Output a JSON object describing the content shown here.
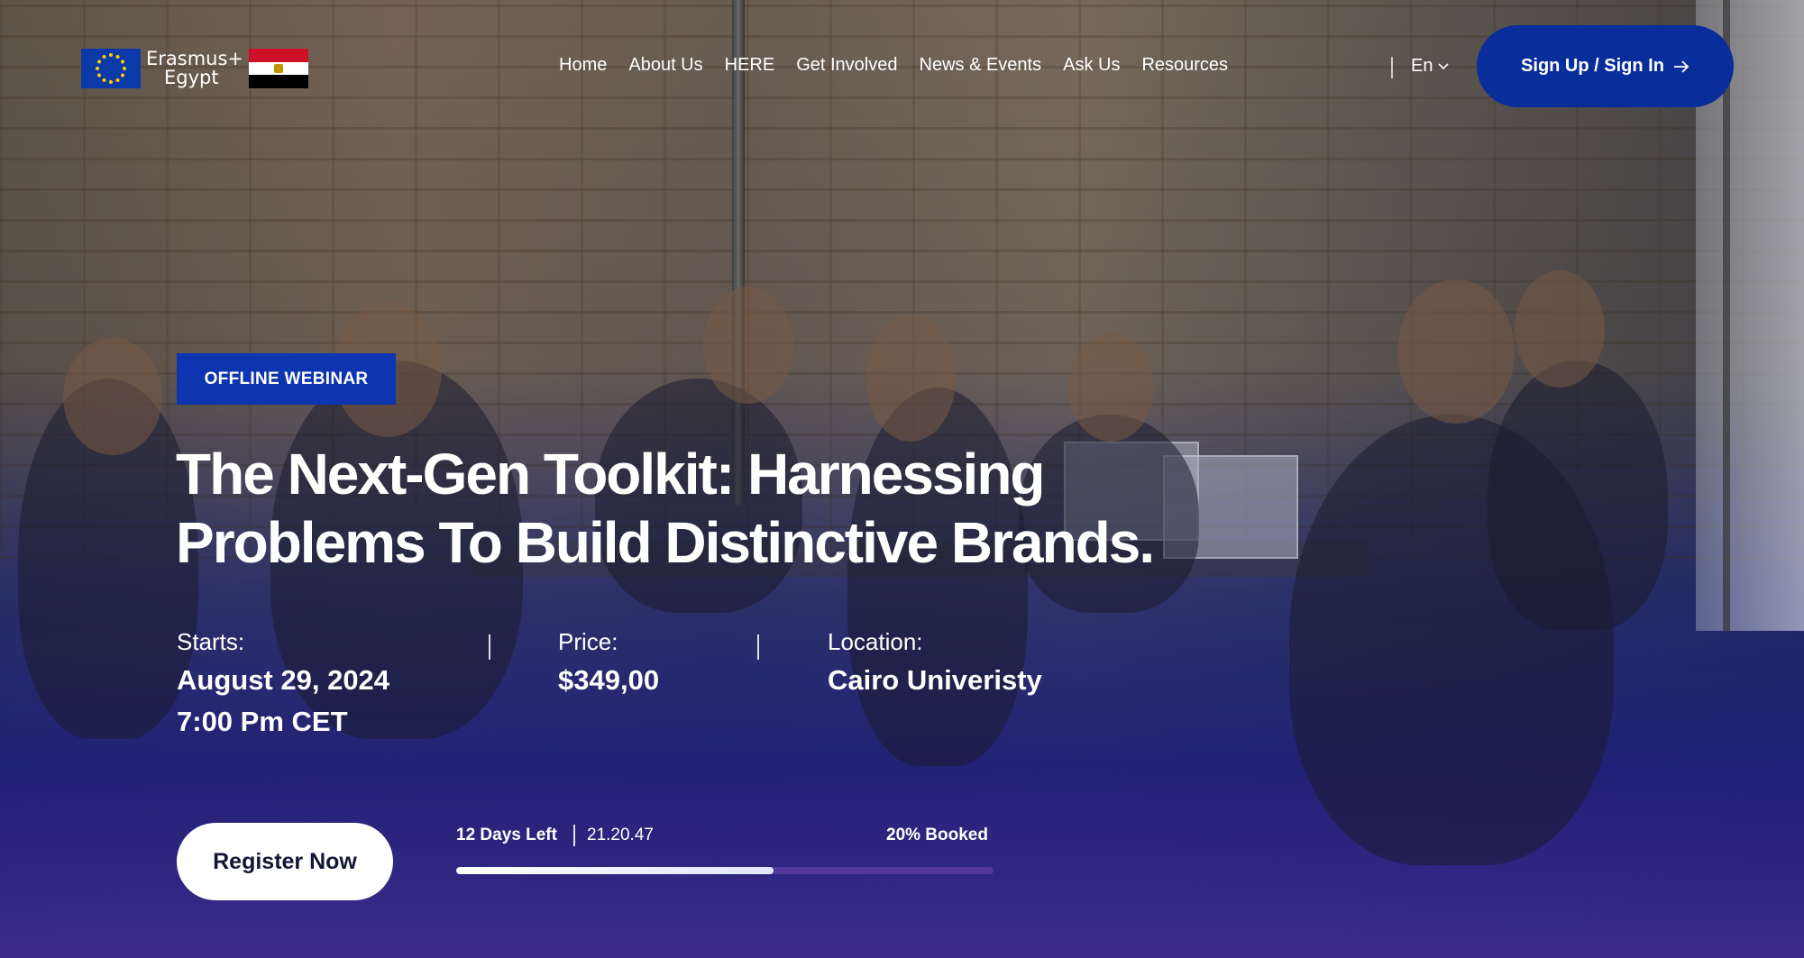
{
  "header": {
    "logo_line1": "Erasmus+",
    "logo_line2": "Egypt",
    "nav": [
      "Home",
      "About Us",
      "HERE",
      "Get Involved",
      "News & Events",
      "Ask Us",
      "Resources"
    ],
    "language": "En",
    "signin_label": "Sign Up / Sign In"
  },
  "event": {
    "badge": "OFFLINE WEBINAR",
    "title_line1": "The Next-Gen Toolkit: Harnessing",
    "title_line2": "Problems To Build Distinctive Brands.",
    "starts_label": "Starts:",
    "starts_date": "August 29, 2024",
    "starts_time": "7:00 Pm CET",
    "price_label": "Price:",
    "price_value": "$349,00",
    "location_label": "Location:",
    "location_value": "Cairo Univeristy",
    "register_label": "Register Now",
    "days_left": "12 Days Left",
    "countdown": "21.20.47",
    "booked_label": "20% Booked",
    "booked_fraction": 0.59
  },
  "colors": {
    "brand_blue": "#0a2d9c",
    "badge_blue": "#0d35b0",
    "egypt_red": "#ce1126",
    "egypt_black": "#000000"
  },
  "icons": {
    "eu_flag": "eu-flag-icon",
    "egypt_flag": "egypt-flag-icon",
    "chevron": "chevron-down-icon",
    "arrow": "arrow-right-icon"
  }
}
